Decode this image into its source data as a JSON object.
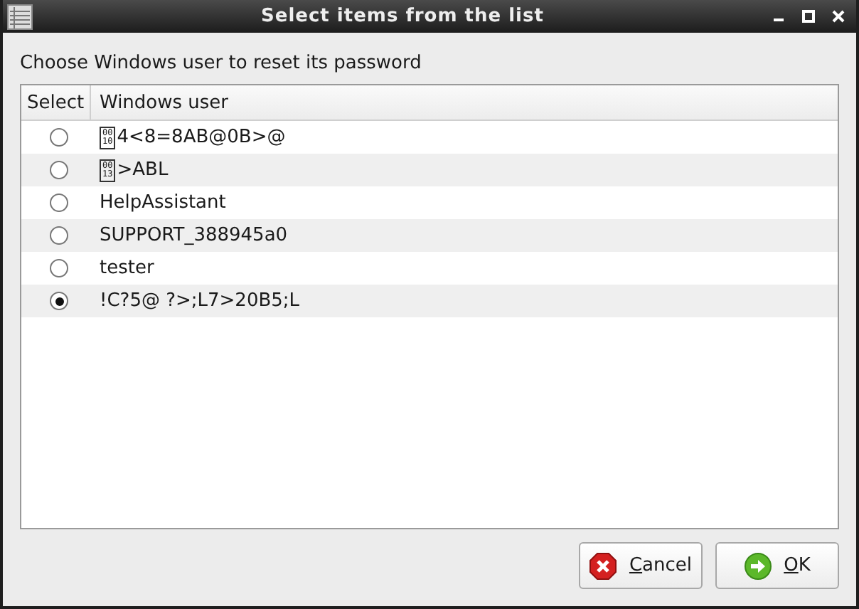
{
  "window": {
    "title": "Select items from the list"
  },
  "prompt": "Choose Windows user to reset its password",
  "table": {
    "columns": [
      "Select",
      "Windows user"
    ],
    "rows": [
      {
        "selected": false,
        "code": "0010",
        "user": "4<8=8AB@0B>@"
      },
      {
        "selected": false,
        "code": "0013",
        "user": ">ABL"
      },
      {
        "selected": false,
        "user": "HelpAssistant"
      },
      {
        "selected": false,
        "user": "SUPPORT_388945a0"
      },
      {
        "selected": false,
        "user": "tester"
      },
      {
        "selected": true,
        "user": "!C?5@ ?>;L7>20B5;L"
      }
    ]
  },
  "buttons": [
    {
      "kind": "cancel",
      "label": "Cancel"
    },
    {
      "kind": "ok",
      "label": "OK"
    }
  ]
}
